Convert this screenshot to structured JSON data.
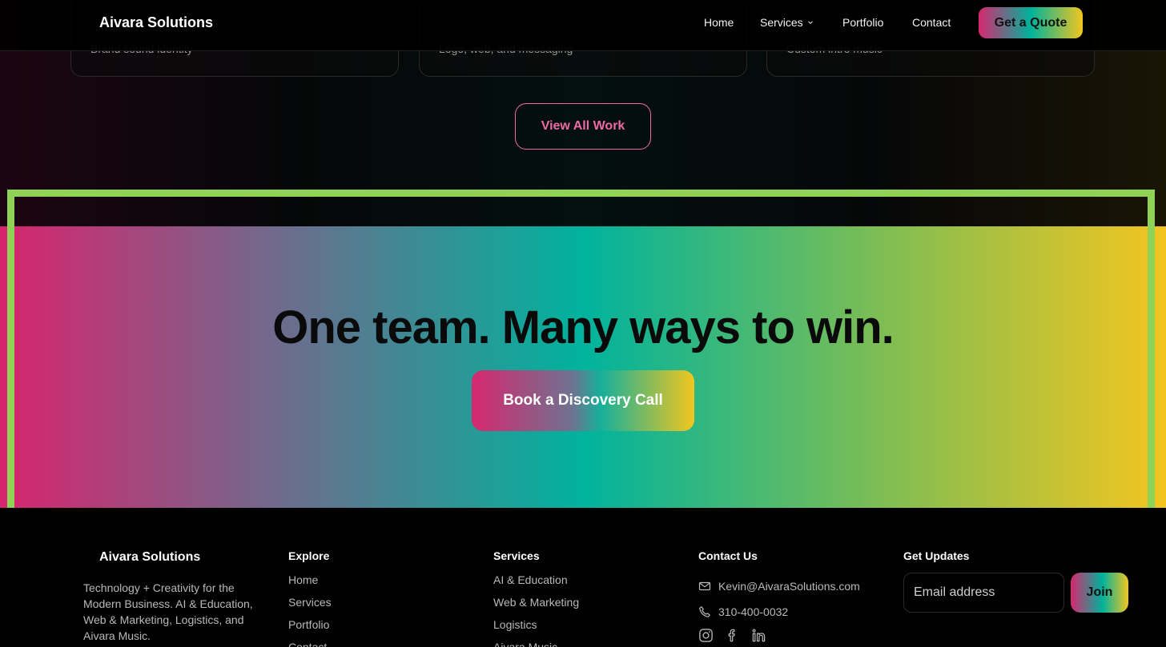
{
  "nav": {
    "brand": "Aivara Solutions",
    "links": [
      "Home",
      "Services",
      "Portfolio",
      "Contact"
    ],
    "cta": "Get a Quote"
  },
  "cards": [
    {
      "subtitle": "Brand sound identity"
    },
    {
      "subtitle": "Logo, web, and messaging"
    },
    {
      "subtitle": "Custom intro music"
    }
  ],
  "portfolio": {
    "view_all": "View All Work"
  },
  "cta_band": {
    "title": "One team. Many ways to win.",
    "button": "Book a Discovery Call"
  },
  "footer": {
    "brand": "Aivara Solutions",
    "tagline": "Technology + Creativity for the Modern Business. AI & Education, Web & Marketing, Logistics, and Aivara Music.",
    "explore": {
      "heading": "Explore",
      "items": [
        "Home",
        "Services",
        "Portfolio",
        "Contact"
      ]
    },
    "services": {
      "heading": "Services",
      "items": [
        "AI & Education",
        "Web & Marketing",
        "Logistics",
        "Aivara Music"
      ]
    },
    "contact": {
      "heading": "Contact Us",
      "email": "Kevin@AivaraSolutions.com",
      "phone": "310-400-0032",
      "social": [
        "instagram-icon",
        "facebook-icon",
        "linkedin-icon"
      ]
    },
    "updates": {
      "heading": "Get Updates",
      "placeholder": "Email address",
      "button": "Join"
    }
  },
  "colors": {
    "pink": "#d6286f",
    "teal": "#00b29c",
    "yellow": "#f2c61f",
    "highlight": "#8fd255"
  }
}
